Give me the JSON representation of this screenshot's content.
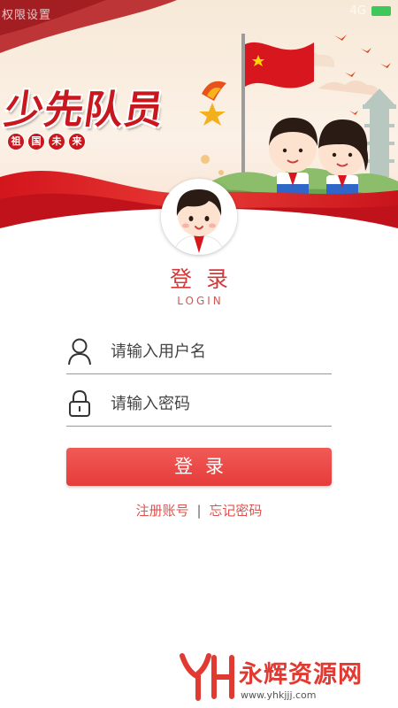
{
  "status_bar": {
    "left_text": "权限设置",
    "right_text": "4G"
  },
  "banner": {
    "title": "少先队员",
    "subtitle_chars": [
      "祖",
      "国",
      "未",
      "来"
    ]
  },
  "login": {
    "title": "登录",
    "subtitle": "LOGIN",
    "username_placeholder": "请输入用户名",
    "password_placeholder": "请输入密码",
    "button_label": "登录",
    "register_link": "注册账号",
    "separator": "|",
    "forgot_link": "忘记密码"
  },
  "watermark": {
    "name": "永辉资源网",
    "url": "www.yhkjjj.com"
  },
  "colors": {
    "accent": "#e63c3a",
    "title_red": "#c9171e"
  },
  "icons": {
    "user": "user-icon",
    "lock": "lock-icon",
    "avatar": "pioneer-avatar",
    "flag": "flag-icon",
    "torch": "torch-icon"
  }
}
